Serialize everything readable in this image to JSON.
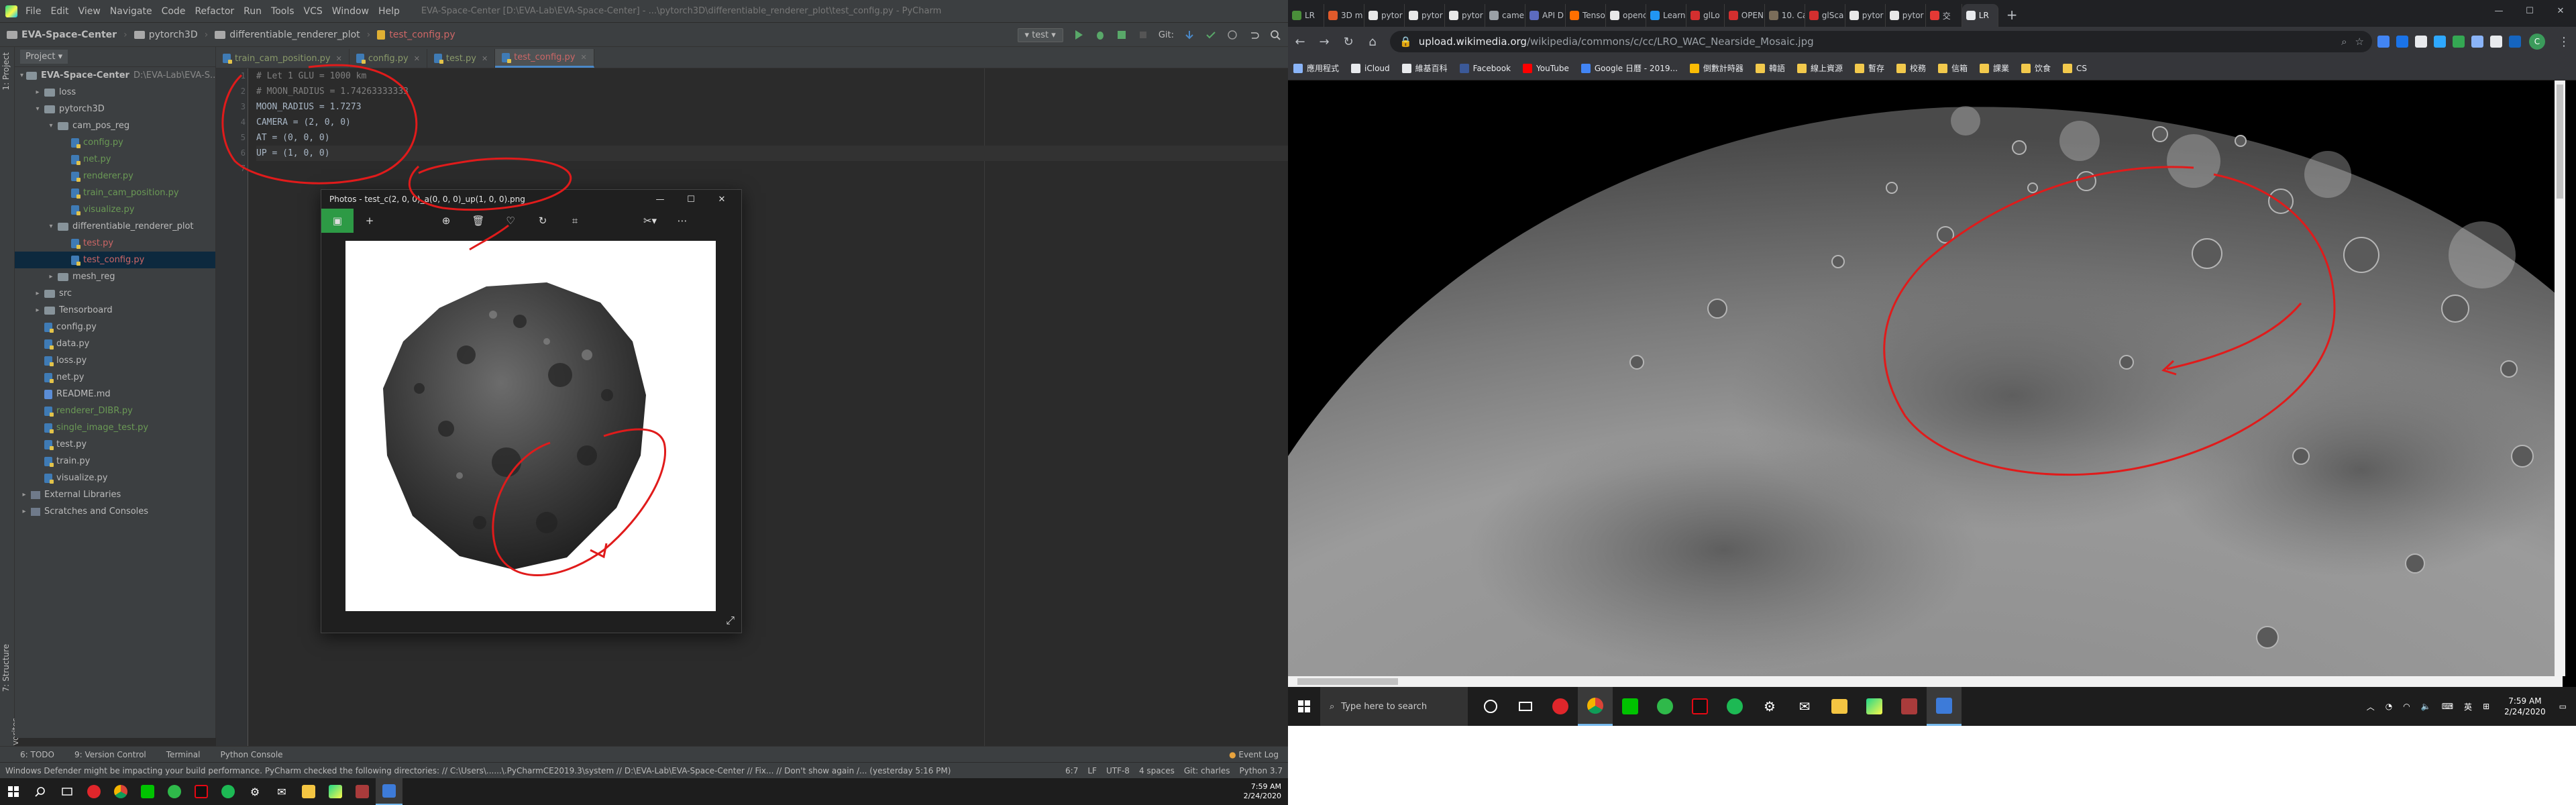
{
  "ide": {
    "menu": [
      "File",
      "Edit",
      "View",
      "Navigate",
      "Code",
      "Refactor",
      "Run",
      "Tools",
      "VCS",
      "Window",
      "Help"
    ],
    "title": "EVA-Space-Center [D:\\EVA-Lab\\EVA-Space-Center] - ...\\pytorch3D\\differentiable_renderer_plot\\test_config.py - PyCharm",
    "breadcrumbs": [
      "EVA-Space-Center",
      "pytorch3D",
      "differentiable_renderer_plot",
      "test_config.py"
    ],
    "run_config": "test",
    "git_label": "Git:",
    "project_label": "Project",
    "tree": [
      {
        "label": "EVA-Space-Center",
        "extra": "D:\\EVA-Lab\\EVA-S...",
        "depth": 0,
        "type": "folder",
        "open": true
      },
      {
        "label": "loss",
        "depth": 1,
        "type": "folder"
      },
      {
        "label": "pytorch3D",
        "depth": 1,
        "type": "folder",
        "open": true
      },
      {
        "label": "cam_pos_reg",
        "depth": 2,
        "type": "folder",
        "open": true
      },
      {
        "label": "config.py",
        "depth": 3,
        "type": "py",
        "color": "green"
      },
      {
        "label": "net.py",
        "depth": 3,
        "type": "py",
        "color": "green"
      },
      {
        "label": "renderer.py",
        "depth": 3,
        "type": "py",
        "color": "green"
      },
      {
        "label": "train_cam_position.py",
        "depth": 3,
        "type": "py",
        "color": "green"
      },
      {
        "label": "visualize.py",
        "depth": 3,
        "type": "py",
        "color": "green"
      },
      {
        "label": "differentiable_renderer_plot",
        "depth": 2,
        "type": "folder",
        "open": true
      },
      {
        "label": "test.py",
        "depth": 3,
        "type": "py",
        "color": "red"
      },
      {
        "label": "test_config.py",
        "depth": 3,
        "type": "py",
        "color": "red",
        "selected": true
      },
      {
        "label": "mesh_reg",
        "depth": 2,
        "type": "folder"
      },
      {
        "label": "src",
        "depth": 1,
        "type": "folder"
      },
      {
        "label": "Tensorboard",
        "depth": 1,
        "type": "folder"
      },
      {
        "label": "config.py",
        "depth": 1,
        "type": "py"
      },
      {
        "label": "data.py",
        "depth": 1,
        "type": "py"
      },
      {
        "label": "loss.py",
        "depth": 1,
        "type": "py"
      },
      {
        "label": "net.py",
        "depth": 1,
        "type": "py"
      },
      {
        "label": "README.md",
        "depth": 1,
        "type": "md"
      },
      {
        "label": "renderer_DIBR.py",
        "depth": 1,
        "type": "py",
        "color": "green"
      },
      {
        "label": "single_image_test.py",
        "depth": 1,
        "type": "py",
        "color": "green"
      },
      {
        "label": "test.py",
        "depth": 1,
        "type": "py"
      },
      {
        "label": "train.py",
        "depth": 1,
        "type": "py"
      },
      {
        "label": "visualize.py",
        "depth": 1,
        "type": "py"
      },
      {
        "label": "External Libraries",
        "depth": 0,
        "type": "lib"
      },
      {
        "label": "Scratches and Consoles",
        "depth": 0,
        "type": "lib"
      }
    ],
    "tabs": [
      {
        "label": "train_cam_position.py",
        "active": false
      },
      {
        "label": "config.py",
        "active": false
      },
      {
        "label": "test.py",
        "active": false
      },
      {
        "label": "test_config.py",
        "active": true
      }
    ],
    "code": [
      {
        "n": "1",
        "text": "# Let 1 GLU = 1000 km",
        "kind": "comment"
      },
      {
        "n": "2",
        "text": "# MOON_RADIUS = 1.74263333333",
        "kind": "comment"
      },
      {
        "n": "3",
        "text": "MOON_RADIUS = 1.7273",
        "kind": "code"
      },
      {
        "n": "4",
        "text": "CAMERA = (2, 0, 0)",
        "kind": "code"
      },
      {
        "n": "5",
        "text": "AT = (0, 0, 0)",
        "kind": "code"
      },
      {
        "n": "6",
        "text": "UP = (1, 0, 0)",
        "kind": "code",
        "current": true
      },
      {
        "n": "7",
        "text": "",
        "kind": "code"
      }
    ],
    "left_strip": [
      "1: Project",
      "7: Structure",
      "2: Favorites"
    ],
    "bottom_tools": [
      "6: TODO",
      "9: Version Control",
      "Terminal",
      "Python Console"
    ],
    "event_log": "Event Log",
    "status_msg": "Windows Defender might be impacting your build performance. PyCharm checked the following directories: // C:\\Users\\......\\.PyCharmCE2019.3\\system // D:\\EVA-Lab\\EVA-Space-Center // Fix... // Don't show again /... (yesterday 5:16 PM)",
    "status_right": [
      "6:7",
      "LF",
      "UTF-8",
      "4 spaces",
      "Git: charles",
      "Python 3.7"
    ]
  },
  "photos": {
    "title": "Photos - test_c(2, 0, 0)_a(0, 0, 0)_up(1, 0, 0).png",
    "tools": [
      "image-icon",
      "add-icon",
      "zoom-icon",
      "delete-icon",
      "heart-icon",
      "rotate-icon",
      "crop-icon",
      "edit-icon",
      "more-icon"
    ]
  },
  "taskbar_small": {
    "time": "7:59 AM",
    "date": "2/24/2020"
  },
  "chrome": {
    "tabs": [
      {
        "label": "LR",
        "color": "#4a8f3a"
      },
      {
        "label": "3D m",
        "color": "#e05a2b"
      },
      {
        "label": "pytor",
        "color": "#e8e8e8"
      },
      {
        "label": "pytor",
        "color": "#e8e8e8"
      },
      {
        "label": "pytor",
        "color": "#e8e8e8"
      },
      {
        "label": "came",
        "color": "#9aa0a6"
      },
      {
        "label": "API D",
        "color": "#5c6bc0"
      },
      {
        "label": "Tenso",
        "color": "#ff6f00"
      },
      {
        "label": "openc",
        "color": "#e8e8e8"
      },
      {
        "label": "Learn",
        "color": "#2196f3"
      },
      {
        "label": "glLo",
        "color": "#d32f2f"
      },
      {
        "label": "OPEN",
        "color": "#d32f2f"
      },
      {
        "label": "10. Ca",
        "color": "#7b6d5a"
      },
      {
        "label": "glSca",
        "color": "#d32f2f"
      },
      {
        "label": "pytor",
        "color": "#e8e8e8"
      },
      {
        "label": "pytor",
        "color": "#e8e8e8"
      },
      {
        "label": "交",
        "color": "#e53935"
      },
      {
        "label": "LR",
        "color": "#e8eaed",
        "active": true
      }
    ],
    "url_host": "upload.wikimedia.org",
    "url_path": "/wikipedia/commons/c/cc/LRO_WAC_Nearside_Mosaic.jpg",
    "avatar": "C",
    "bookmarks": [
      {
        "label": "應用程式",
        "color": "#8ab4f8"
      },
      {
        "label": "iCloud",
        "color": "#e8eaed"
      },
      {
        "label": "維基百科",
        "color": "#e8eaed"
      },
      {
        "label": "Facebook",
        "color": "#3b5998"
      },
      {
        "label": "YouTube",
        "color": "#ff0000"
      },
      {
        "label": "Google 日曆 - 2019...",
        "color": "#4285f4"
      },
      {
        "label": "倒數計時器",
        "color": "#fbbc05"
      },
      {
        "label": "韓語",
        "color": "#f2c94c"
      },
      {
        "label": "線上資源",
        "color": "#f2c94c"
      },
      {
        "label": "暫存",
        "color": "#f2c94c"
      },
      {
        "label": "校務",
        "color": "#f2c94c"
      },
      {
        "label": "信箱",
        "color": "#f2c94c"
      },
      {
        "label": "課業",
        "color": "#f2c94c"
      },
      {
        "label": "饮食",
        "color": "#f2c94c"
      },
      {
        "label": "CS",
        "color": "#f2c94c"
      }
    ]
  },
  "taskbar_large": {
    "search_placeholder": "Type here to search",
    "time": "7:59 AM",
    "date": "2/24/2020"
  },
  "colors": {
    "annotation": "#e01b1b",
    "ide_bg": "#2b2b2b",
    "chrome_dark": "#35363a",
    "taskbar": "#1d1d1d"
  }
}
